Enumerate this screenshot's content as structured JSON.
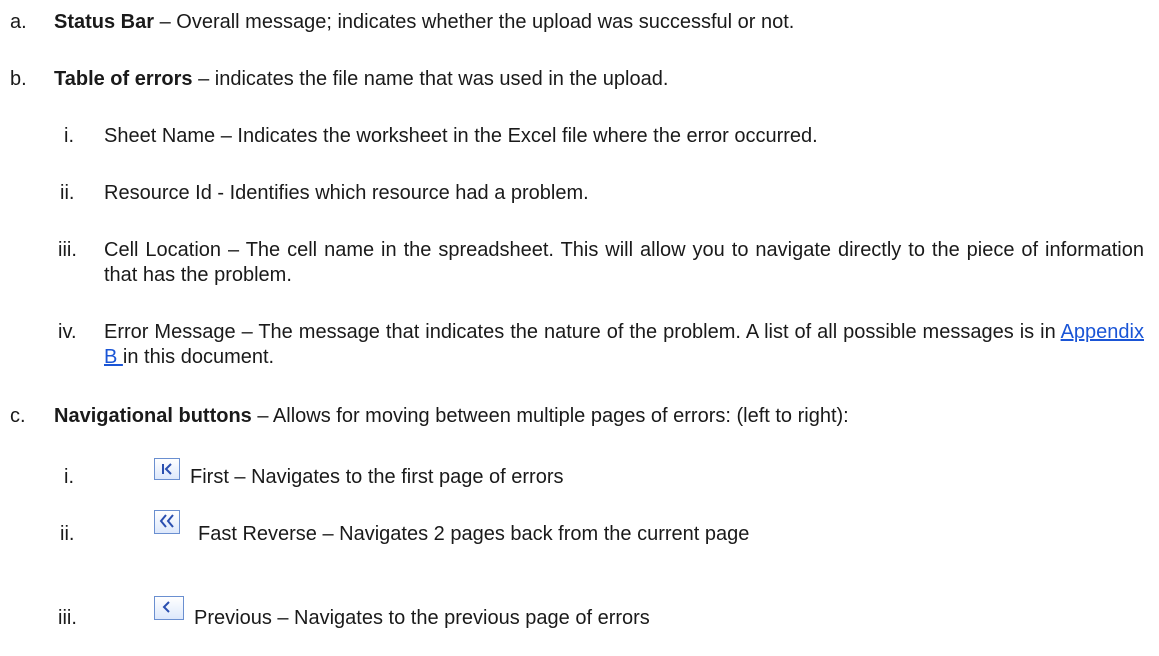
{
  "items": {
    "a": {
      "marker": "a.",
      "term": "Status Bar",
      "text": " – Overall message; indicates whether the upload was successful or not."
    },
    "b": {
      "marker": "b.",
      "term": "Table of errors",
      "text": " – indicates the file name that was used in the upload."
    },
    "b_sub": [
      {
        "marker": "i.",
        "text": "Sheet Name – Indicates the worksheet in the Excel file where the error occurred."
      },
      {
        "marker": "ii.",
        "text": "Resource Id - Identifies which resource had a problem."
      },
      {
        "marker": "iii.",
        "text": "Cell Location – The cell name in the spreadsheet. This will allow you to navigate directly to the piece of information that has the problem."
      },
      {
        "marker": "iv.",
        "text_before": "Error Message – The message that indicates the nature of the problem. A list of all possible messages is in ",
        "link": "Appendix B ",
        "text_after": "in this document."
      }
    ],
    "c": {
      "marker": "c.",
      "term": "Navigational buttons",
      "text": " – Allows for moving between multiple pages of errors: (left to right):"
    },
    "c_sub": [
      {
        "marker": "i.",
        "icon": "first-page-icon",
        "text": "First – Navigates to the first page of errors"
      },
      {
        "marker": "ii.",
        "icon": "fast-reverse-icon",
        "text": "Fast Reverse – Navigates 2 pages back from the current page"
      },
      {
        "marker": "iii.",
        "icon": "previous-page-icon",
        "text": "Previous – Navigates to the previous page of errors"
      }
    ]
  },
  "colors": {
    "link": "#1a55d6",
    "icon_border": "#6a8fd0",
    "icon_glyph": "#2a4fb0"
  }
}
